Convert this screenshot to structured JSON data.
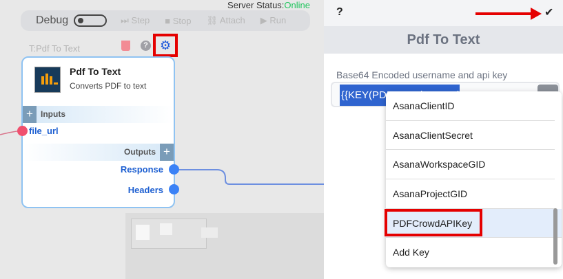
{
  "server_status": {
    "label": "Server Status:",
    "value": "Online",
    "color": "#22c55e"
  },
  "debug": {
    "label": "Debug",
    "toggle_on": false,
    "buttons": [
      {
        "icon": "step-icon",
        "glyph": "⏭",
        "label": "Step"
      },
      {
        "icon": "stop-icon",
        "glyph": "■",
        "label": "Stop"
      },
      {
        "icon": "link-icon",
        "glyph": "🔗",
        "label": "Attach"
      },
      {
        "icon": "play-icon",
        "glyph": "▶",
        "label": "Run"
      }
    ]
  },
  "node": {
    "caption": "T:Pdf To Text",
    "title": "Pdf To Text",
    "description": "Converts PDF to text",
    "inputs_label": "Inputs",
    "outputs_label": "Outputs",
    "inputs": [
      "file_url"
    ],
    "outputs": [
      "Response",
      "Headers"
    ],
    "help_glyph": "?"
  },
  "panel": {
    "help": "?",
    "confirm": "✔",
    "title": "Pdf To Text",
    "field_label": "Base64 Encoded username and api key",
    "field_value": "{{KEY(PDFCrowdAPIKey)}}",
    "dropdown": [
      "AsanaClientID",
      "AsanaClientSecret",
      "AsanaWorkspaceGID",
      "AsanaProjectGID",
      "PDFCrowdAPIKey",
      "Add Key"
    ],
    "selected": "PDFCrowdAPIKey"
  },
  "colors": {
    "accent": "#1a56db",
    "highlight": "#e50000",
    "input_port": "#f0506e",
    "output_port": "#3b82f6"
  }
}
